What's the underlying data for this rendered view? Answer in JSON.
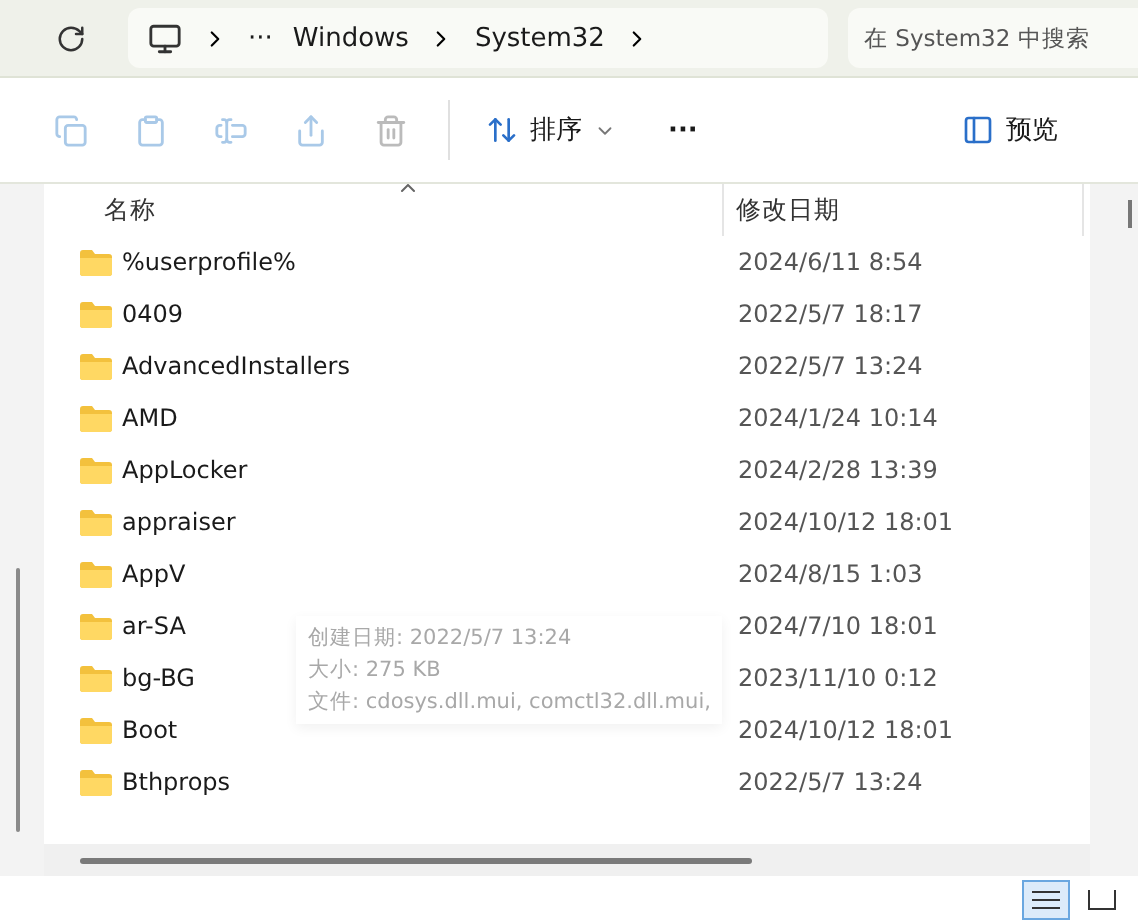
{
  "address_bar": {
    "crumbs": [
      "Windows",
      "System32"
    ],
    "overflow": "···"
  },
  "search": {
    "placeholder": "在 System32 中搜索"
  },
  "toolbar": {
    "sort": "排序",
    "more": "···",
    "preview": "预览"
  },
  "columns": [
    "名称",
    "修改日期"
  ],
  "rows": [
    {
      "name": "%userprofile%",
      "date": "2024/6/11 8:54"
    },
    {
      "name": "0409",
      "date": "2022/5/7 18:17"
    },
    {
      "name": "AdvancedInstallers",
      "date": "2022/5/7 13:24"
    },
    {
      "name": "AMD",
      "date": "2024/1/24 10:14"
    },
    {
      "name": "AppLocker",
      "date": "2024/2/28 13:39"
    },
    {
      "name": "appraiser",
      "date": "2024/10/12 18:01"
    },
    {
      "name": "AppV",
      "date": "2024/8/15 1:03"
    },
    {
      "name": "ar-SA",
      "date": "2024/7/10 18:01"
    },
    {
      "name": "bg-BG",
      "date": "2023/11/10 0:12"
    },
    {
      "name": "Boot",
      "date": "2024/10/12 18:01"
    },
    {
      "name": "Bthprops",
      "date": "2022/5/7 13:24"
    }
  ],
  "tooltip": [
    "创建日期: 2022/5/7 13:24",
    "大小: 275 KB",
    "文件: cdosys.dll.mui, comctl32.dll.mui,"
  ],
  "views": [
    {
      "kind": "details",
      "selected": true
    },
    {
      "kind": "tiles",
      "selected": false
    }
  ]
}
